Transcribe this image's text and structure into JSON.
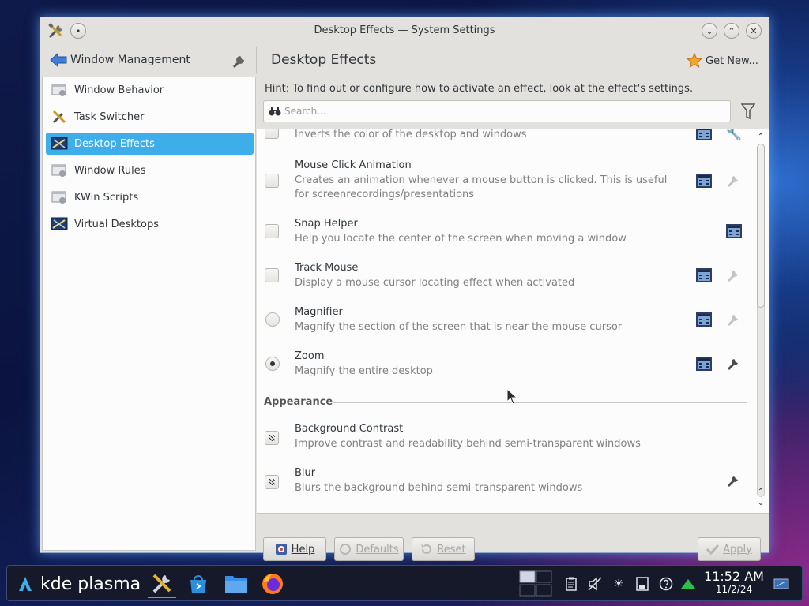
{
  "window": {
    "title": "Desktop Effects — System Settings"
  },
  "header": {
    "category": "Window Management",
    "page_title": "Desktop Effects",
    "get_new": "Get New..."
  },
  "sidebar": {
    "items": [
      {
        "label": "Window Behavior",
        "icon": "window-behavior-icon"
      },
      {
        "label": "Task Switcher",
        "icon": "task-switcher-icon"
      },
      {
        "label": "Desktop Effects",
        "icon": "desktop-effects-icon",
        "selected": true
      },
      {
        "label": "Window Rules",
        "icon": "window-rules-icon"
      },
      {
        "label": "KWin Scripts",
        "icon": "kwin-scripts-icon"
      },
      {
        "label": "Virtual Desktops",
        "icon": "virtual-desktops-icon"
      }
    ]
  },
  "content": {
    "hint": "Hint: To find out or configure how to activate an effect, look at the effect's settings.",
    "search_placeholder": "Search...",
    "effects": [
      {
        "name": "",
        "desc": "Inverts the color of the desktop and windows"
      },
      {
        "name": "Mouse Click Animation",
        "desc": "Creates an animation whenever a mouse button is clicked. This is useful for screenrecordings/presentations"
      },
      {
        "name": "Snap Helper",
        "desc": "Help you locate the center of the screen when moving a window"
      },
      {
        "name": "Track Mouse",
        "desc": "Display a mouse cursor locating effect when activated"
      },
      {
        "name": "Magnifier",
        "desc": "Magnify the section of the screen that is near the mouse cursor"
      },
      {
        "name": "Zoom",
        "desc": "Magnify the entire desktop",
        "checked": true
      }
    ],
    "group": "Appearance",
    "appearance_effects": [
      {
        "name": "Background Contrast",
        "desc": "Improve contrast and readability behind semi-transparent windows"
      },
      {
        "name": "Blur",
        "desc": "Blurs the background behind semi-transparent windows"
      }
    ]
  },
  "buttons": {
    "help": "Help",
    "defaults": "Defaults",
    "reset": "Reset",
    "apply": "Apply"
  },
  "taskbar": {
    "launcher": "kde plasma",
    "time": "11:52 AM",
    "date": "11/2/24"
  },
  "colors": {
    "selection": "#3daee9",
    "window_bg": "#e3e1de",
    "taskbar_bg": "#15192a"
  }
}
